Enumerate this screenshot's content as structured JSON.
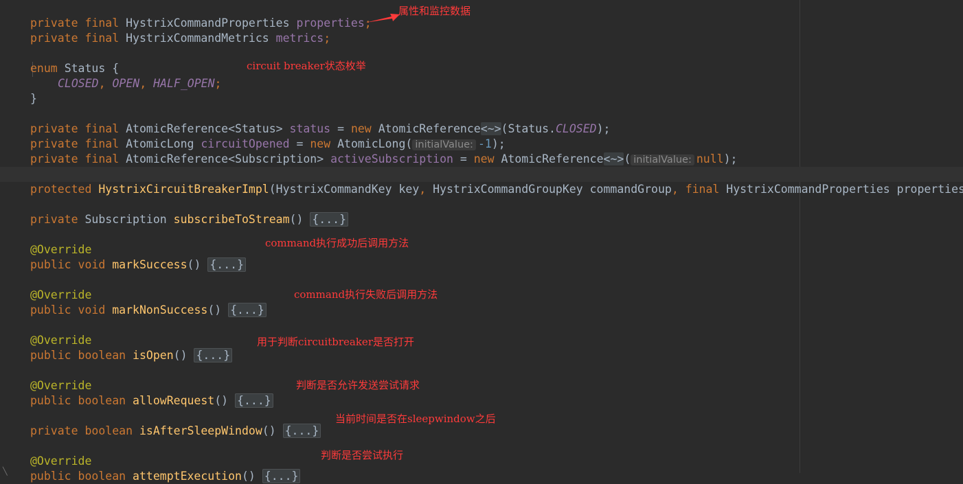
{
  "code": {
    "properties_decl": [
      "private",
      "final",
      "HystrixCommandProperties",
      "properties",
      ";"
    ],
    "metrics_decl": [
      "private",
      "final",
      "HystrixCommandMetrics",
      "metrics",
      ";"
    ],
    "enum_decl": [
      "enum",
      "Status {"
    ],
    "enum_values": [
      "CLOSED",
      ", ",
      "OPEN",
      ", ",
      "HALF_OPEN",
      ";"
    ],
    "enum_close": "}",
    "status_decl": [
      "private",
      "final",
      "AtomicReference<Status>",
      "status",
      "=",
      "new",
      "AtomicReference",
      "<~>",
      "(Status.",
      "CLOSED",
      ");"
    ],
    "circuit_opened_decl": [
      "private",
      "final",
      "AtomicLong",
      "circuitOpened",
      "=",
      "new",
      "AtomicLong(",
      "initialValue:",
      "-1",
      ");"
    ],
    "active_subscription_decl": [
      "private",
      "final",
      "AtomicReference<Subscription>",
      "activeSubscription",
      "=",
      "new",
      "AtomicReference",
      "<~>",
      "(",
      "initialValue:",
      "null",
      ");"
    ],
    "constructor_decl": [
      "protected",
      "HystrixCircuitBreakerImpl",
      "(HystrixCommandKey key",
      ",",
      " HystrixCommandGroupKey commandGroup",
      ",",
      "final",
      "HystrixCommandProperties properties"
    ],
    "subscribe_decl": [
      "private",
      "Subscription",
      "subscribeToStream",
      "()",
      "{...}"
    ],
    "override_label": "@Override",
    "mark_success_decl": [
      "public",
      "void",
      "markSuccess",
      "()",
      "{...}"
    ],
    "mark_non_success_decl": [
      "public",
      "void",
      "markNonSuccess",
      "()",
      "{...}"
    ],
    "is_open_decl": [
      "public",
      "boolean",
      "isOpen",
      "()",
      "{...}"
    ],
    "allow_request_decl": [
      "public",
      "boolean",
      "allowRequest",
      "()",
      "{...}"
    ],
    "is_after_sleep_decl": [
      "private",
      "boolean",
      "isAfterSleepWindow",
      "()",
      "{...}"
    ],
    "attempt_execution_decl": [
      "public",
      "boolean",
      "attemptExecution",
      "()",
      "{...}"
    ]
  },
  "notes": {
    "properties_metrics": "属性和监控数据",
    "status_enum": "circuit breaker状态枚举",
    "mark_success": "command执行成功后调用方法",
    "mark_non_success": "command执行失败后调用方法",
    "is_open": "用于判断circuitbreaker是否打开",
    "allow_request": "判断是否允许发送尝试请求",
    "is_after_sleep": "当前时间是否在sleepwindow之后",
    "attempt_execution": "判断是否尝试执行"
  },
  "colors": {
    "background": "#2b2b2b",
    "keyword": "#cc7832",
    "field": "#9876aa",
    "method": "#ffc66d",
    "annotation": "#bbb529",
    "number": "#6897bb",
    "note": "#ff3b3b"
  }
}
